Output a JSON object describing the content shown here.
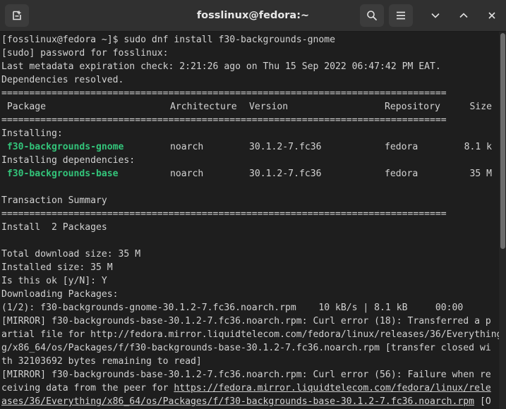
{
  "window": {
    "title": "fosslinux@fedora:~",
    "icons": {
      "new_tab": "new-tab-icon",
      "search": "search-icon",
      "menu": "hamburger-menu-icon",
      "minimize": "chevron-down-icon",
      "maximize": "chevron-up-icon",
      "close": "close-icon"
    }
  },
  "terminal": {
    "lines": [
      {
        "text": "[fosslinux@fedora ~]$ sudo dnf install f30-backgrounds-gnome"
      },
      {
        "text": "[sudo] password for fosslinux:"
      },
      {
        "text": "Last metadata expiration check: 2:21:26 ago on Thu 15 Sep 2022 06:47:42 PM EAT."
      },
      {
        "text": "Dependencies resolved."
      },
      {
        "text": "================================================================================"
      },
      {
        "header": true,
        "cols": [
          " Package",
          "Architecture",
          "Version",
          "Repository",
          "Size"
        ]
      },
      {
        "text": "================================================================================"
      },
      {
        "text": "Installing:"
      },
      {
        "pkg": true,
        "cols": [
          " f30-backgrounds-gnome",
          "noarch",
          "30.1.2-7.fc36",
          "fedora",
          "8.1 k"
        ]
      },
      {
        "text": "Installing dependencies:"
      },
      {
        "pkg": true,
        "cols": [
          " f30-backgrounds-base",
          "noarch",
          "30.1.2-7.fc36",
          "fedora",
          "35 M"
        ]
      },
      {
        "text": ""
      },
      {
        "text": "Transaction Summary"
      },
      {
        "text": "================================================================================"
      },
      {
        "text": "Install  2 Packages"
      },
      {
        "text": ""
      },
      {
        "text": "Total download size: 35 M"
      },
      {
        "text": "Installed size: 35 M"
      },
      {
        "text": "Is this ok [y/N]: Y"
      },
      {
        "text": "Downloading Packages:"
      },
      {
        "text": "(1/2): f30-backgrounds-gnome-30.1.2-7.fc36.noarch.rpm    10 kB/s | 8.1 kB     00:00"
      },
      {
        "text": "[MIRROR] f30-backgrounds-base-30.1.2-7.fc36.noarch.rpm: Curl error (18): Transferred a p"
      },
      {
        "text": "artial file for http://fedora.mirror.liquidtelecom.com/fedora/linux/releases/36/Everything"
      },
      {
        "text": "g/x86_64/os/Packages/f/f30-backgrounds-base-30.1.2-7.fc36.noarch.rpm [transfer closed wi"
      },
      {
        "text": "th 32103692 bytes remaining to read]"
      },
      {
        "text": "[MIRROR] f30-backgrounds-base-30.1.2-7.fc36.noarch.rpm: Curl error (56): Failure when re"
      },
      {
        "parts": [
          {
            "text": "ceiving data from the peer for "
          },
          {
            "text": "https://fedora.mirror.liquidtelecom.com/fedora/linux/rele",
            "url": true
          }
        ]
      },
      {
        "parts": [
          {
            "text": "ases/36/Everything/x86_64/os/Packages/f/f30-backgrounds-base-30.1.2-7.fc36.noarch.rpm",
            "url": true
          },
          {
            "text": " [O"
          }
        ]
      }
    ]
  }
}
